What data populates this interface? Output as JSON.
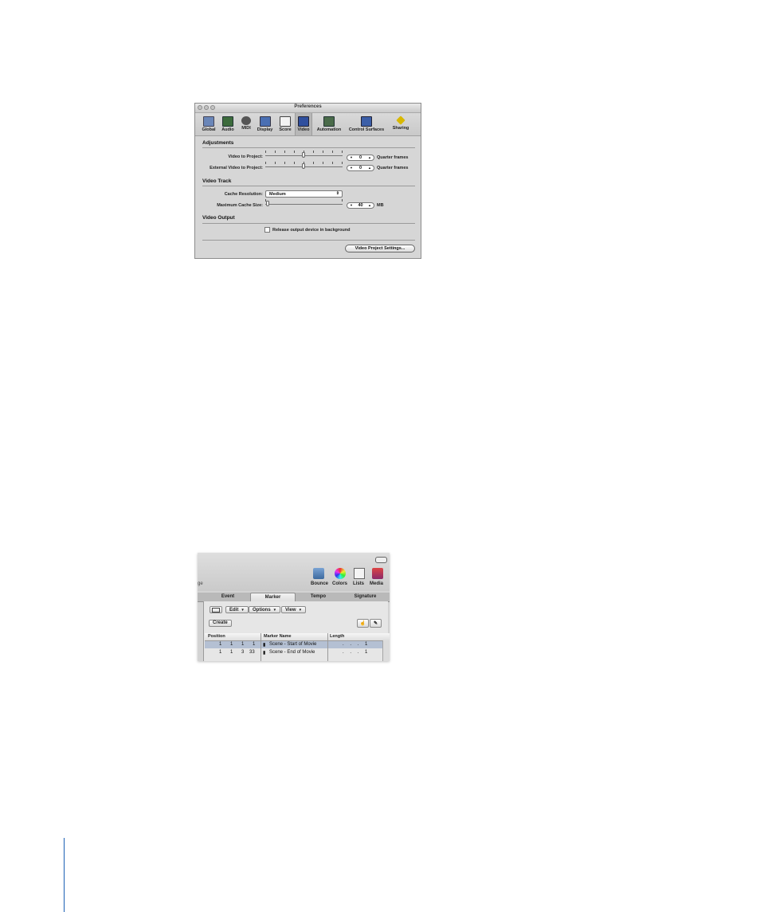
{
  "preferences": {
    "window_title": "Preferences",
    "toolbar": [
      {
        "label": "Global",
        "icon": "global-icon",
        "color": "#6a86b8"
      },
      {
        "label": "Audio",
        "icon": "audio-icon",
        "color": "#3c6b3c"
      },
      {
        "label": "MIDI",
        "icon": "midi-icon",
        "color": "#555555"
      },
      {
        "label": "Display",
        "icon": "display-icon",
        "color": "#4a6fb3"
      },
      {
        "label": "Score",
        "icon": "score-icon",
        "color": "#444444"
      },
      {
        "label": "Video",
        "icon": "video-icon",
        "color": "#2f4f9e"
      },
      {
        "label": "Automation",
        "icon": "automation-icon",
        "color": "#4a6b4a"
      },
      {
        "label": "Control Surfaces",
        "icon": "control-surfaces-icon",
        "color": "#3c5fa8"
      },
      {
        "label": "Sharing",
        "icon": "sharing-icon",
        "color": "#d8b800"
      }
    ],
    "selected_tab": "Video",
    "adjustments": {
      "heading": "Adjustments",
      "video_to_project": {
        "label": "Video to Project:",
        "value": "0",
        "unit": "Quarter frames",
        "slider_position": 0.5
      },
      "external_video_to_project": {
        "label": "External Video to Project:",
        "value": "0",
        "unit": "Quarter frames",
        "slider_position": 0.5
      }
    },
    "video_track": {
      "heading": "Video Track",
      "cache_resolution": {
        "label": "Cache Resolution:",
        "value": "Medium"
      },
      "max_cache_size": {
        "label": "Maximum Cache Size:",
        "value": "40",
        "unit": "MB",
        "slider_position": 0.0
      }
    },
    "video_output": {
      "heading": "Video Output",
      "release_checkbox": {
        "label": "Release output device in background",
        "checked": false
      }
    },
    "video_project_settings_button": "Video Project Settings..."
  },
  "logic": {
    "cut_text": "ge",
    "toolbar": [
      {
        "label": "Bounce",
        "icon": "bounce-icon"
      },
      {
        "label": "Colors",
        "icon": "colors-icon"
      },
      {
        "label": "Lists",
        "icon": "lists-icon"
      },
      {
        "label": "Media",
        "icon": "media-icon"
      }
    ],
    "tabs": [
      "Event",
      "Marker",
      "Tempo",
      "Signature"
    ],
    "selected_tab": "Marker",
    "menus": [
      "Edit",
      "Options",
      "View"
    ],
    "create_button": "Create",
    "columns": [
      "Position",
      "Marker Name",
      "Length"
    ],
    "rows": [
      {
        "position": [
          "1",
          "1",
          "1",
          "1"
        ],
        "name": "Scene - Start of Movie",
        "length": ". . . 1",
        "selected": true
      },
      {
        "position": [
          "1",
          "1",
          "3",
          "33"
        ],
        "name": "Scene - End of Movie",
        "length": ". . . 1",
        "selected": false
      }
    ]
  }
}
